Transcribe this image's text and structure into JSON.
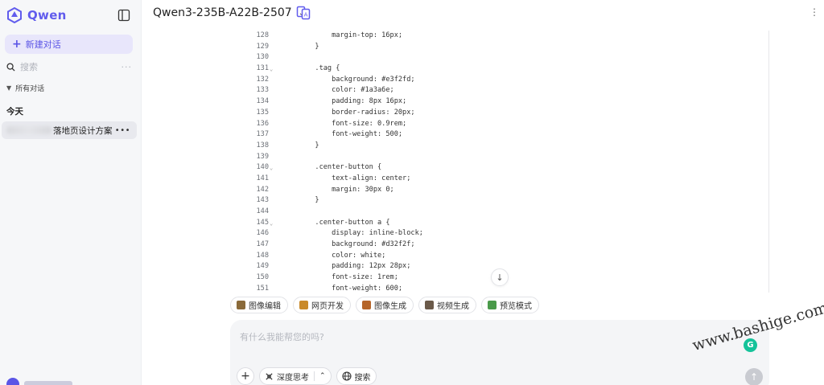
{
  "sidebar": {
    "brand": "Qwen",
    "new_chat_label": "新建对话",
    "search_placeholder": "搜索",
    "section_label": "所有对话",
    "group_label": "今天",
    "chats": [
      {
        "title": "落地页设计方案"
      }
    ]
  },
  "header": {
    "model_name": "Qwen3-235B-A22B-2507"
  },
  "code": {
    "lines": [
      {
        "n": "128",
        "fold": "",
        "text": "            margin-top: 16px;"
      },
      {
        "n": "129",
        "fold": "",
        "text": "        }"
      },
      {
        "n": "130",
        "fold": "",
        "text": ""
      },
      {
        "n": "131",
        "fold": "⌄",
        "text": "        .tag {"
      },
      {
        "n": "132",
        "fold": "",
        "text": "            background: #e3f2fd;"
      },
      {
        "n": "133",
        "fold": "",
        "text": "            color: #1a3a6e;"
      },
      {
        "n": "134",
        "fold": "",
        "text": "            padding: 8px 16px;"
      },
      {
        "n": "135",
        "fold": "",
        "text": "            border-radius: 20px;"
      },
      {
        "n": "136",
        "fold": "",
        "text": "            font-size: 0.9rem;"
      },
      {
        "n": "137",
        "fold": "",
        "text": "            font-weight: 500;"
      },
      {
        "n": "138",
        "fold": "",
        "text": "        }"
      },
      {
        "n": "139",
        "fold": "",
        "text": ""
      },
      {
        "n": "140",
        "fold": "⌄",
        "text": "        .center-button {"
      },
      {
        "n": "141",
        "fold": "",
        "text": "            text-align: center;"
      },
      {
        "n": "142",
        "fold": "",
        "text": "            margin: 30px 0;"
      },
      {
        "n": "143",
        "fold": "",
        "text": "        }"
      },
      {
        "n": "144",
        "fold": "",
        "text": ""
      },
      {
        "n": "145",
        "fold": "⌄",
        "text": "        .center-button a {"
      },
      {
        "n": "146",
        "fold": "",
        "text": "            display: inline-block;"
      },
      {
        "n": "147",
        "fold": "",
        "text": "            background: #d32f2f;"
      },
      {
        "n": "148",
        "fold": "",
        "text": "            color: white;"
      },
      {
        "n": "149",
        "fold": "",
        "text": "            padding: 12px 28px;"
      },
      {
        "n": "150",
        "fold": "",
        "text": "            font-size: 1rem;"
      },
      {
        "n": "151",
        "fold": "",
        "text": "            font-weight: 600;"
      }
    ]
  },
  "tools": [
    {
      "label": "图像编辑",
      "icon": "image-edit-icon",
      "color": "#8a6a3a"
    },
    {
      "label": "网页开发",
      "icon": "web-dev-icon",
      "color": "#c98a2a"
    },
    {
      "label": "图像生成",
      "icon": "image-gen-icon",
      "color": "#b5652a"
    },
    {
      "label": "视频生成",
      "icon": "video-gen-icon",
      "color": "#6b5a4a"
    },
    {
      "label": "预览模式",
      "icon": "preview-icon",
      "color": "#4a9a4a"
    }
  ],
  "input": {
    "placeholder": "有什么我能帮您的吗?",
    "deep_think_label": "深度思考",
    "search_label": "搜索"
  },
  "watermark": "www.bashige.com",
  "colors": {
    "brand": "#615ced",
    "new_chat_bg": "#e8e6fb",
    "grammarly": "#15c39a"
  }
}
